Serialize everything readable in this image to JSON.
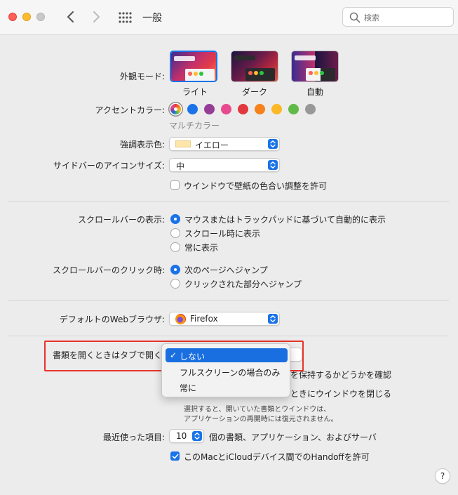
{
  "window": {
    "title": "一般"
  },
  "search": {
    "placeholder": "検索"
  },
  "appearance": {
    "label": "外観モード:",
    "options": [
      {
        "label": "ライト",
        "selected": true
      },
      {
        "label": "ダーク",
        "selected": false
      },
      {
        "label": "自動",
        "selected": false
      }
    ]
  },
  "accent": {
    "label": "アクセントカラー:",
    "caption": "マルチカラー",
    "colors": [
      "multicolor",
      "#1a73e8",
      "#953d96",
      "#e84a8e",
      "#e0383e",
      "#f7821b",
      "#fcb827",
      "#62ba46",
      "#989898"
    ]
  },
  "highlight": {
    "label": "強調表示色:",
    "value": "イエロー",
    "swatch": "#fde6a8"
  },
  "sidebar_icon_size": {
    "label": "サイドバーのアイコンサイズ:",
    "value": "中"
  },
  "wallpaper_tint": {
    "label": "ウインドウで壁紙の色合い調整を許可",
    "checked": false
  },
  "scroll_show": {
    "label": "スクロールバーの表示:",
    "options": [
      {
        "label": "マウスまたはトラックパッドに基づいて自動的に表示",
        "checked": true
      },
      {
        "label": "スクロール時に表示",
        "checked": false
      },
      {
        "label": "常に表示",
        "checked": false
      }
    ]
  },
  "scroll_click": {
    "label": "スクロールバーのクリック時:",
    "options": [
      {
        "label": "次のページへジャンプ",
        "checked": true
      },
      {
        "label": "クリックされた部分へジャンプ",
        "checked": false
      }
    ]
  },
  "browser": {
    "label": "デフォルトのWebブラウザ:",
    "value": "Firefox"
  },
  "tabs": {
    "label": "書類を開くときはタブで開く:",
    "menu": [
      {
        "label": "しない",
        "checked": true
      },
      {
        "label": "フルスクリーンの場合のみ",
        "checked": false
      },
      {
        "label": "常に",
        "checked": false
      }
    ]
  },
  "hidden_rows": {
    "ask_keep": "を保持するかどうかを確認",
    "close_windows": "ときにウインドウを閉じる"
  },
  "restore_note": {
    "line1": "選択すると、開いていた書類とウインドウは、",
    "line2": "アプリケーションの再開時には復元されません。"
  },
  "recent": {
    "label": "最近使った項目:",
    "value": "10",
    "suffix": "個の書類、アプリケーション、およびサーバ"
  },
  "handoff": {
    "label": "このMacとiCloudデバイス間でのHandoffを許可",
    "checked": true
  },
  "help": {
    "label": "?"
  }
}
